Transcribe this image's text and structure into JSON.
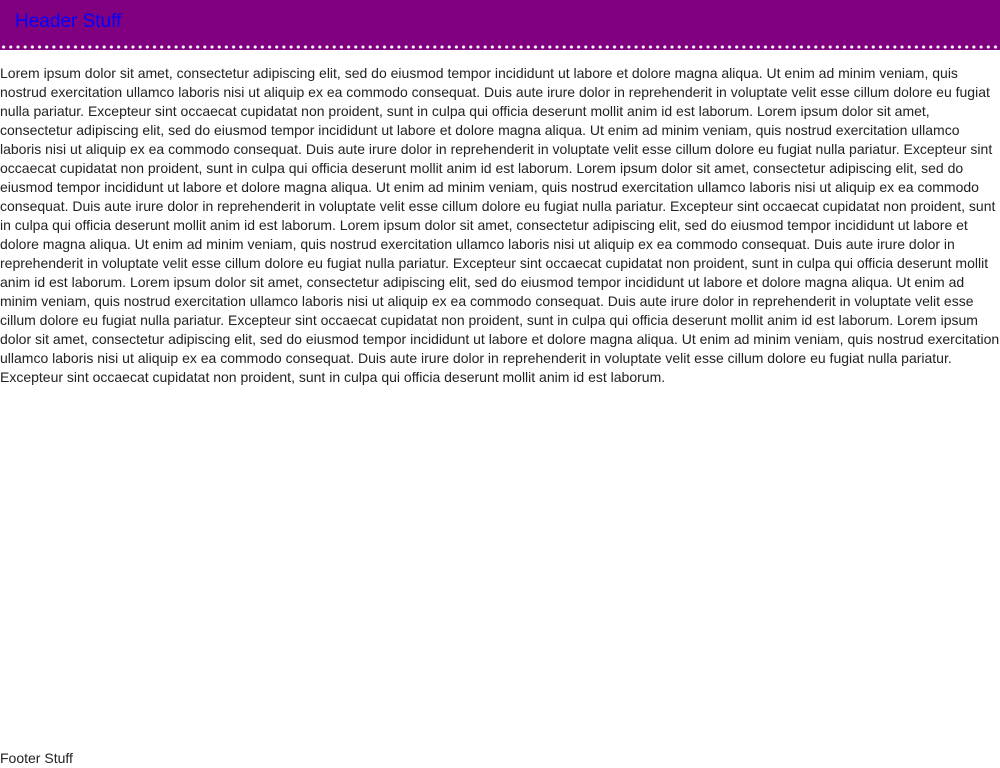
{
  "header": {
    "title": "Header Stuff"
  },
  "main": {
    "body_text": "Lorem ipsum dolor sit amet, consectetur adipiscing elit, sed do eiusmod tempor incididunt ut labore et dolore magna aliqua. Ut enim ad minim veniam, quis nostrud exercitation ullamco laboris nisi ut aliquip ex ea commodo consequat. Duis aute irure dolor in reprehenderit in voluptate velit esse cillum dolore eu fugiat nulla pariatur. Excepteur sint occaecat cupidatat non proident, sunt in culpa qui officia deserunt mollit anim id est laborum. Lorem ipsum dolor sit amet, consectetur adipiscing elit, sed do eiusmod tempor incididunt ut labore et dolore magna aliqua. Ut enim ad minim veniam, quis nostrud exercitation ullamco laboris nisi ut aliquip ex ea commodo consequat. Duis aute irure dolor in reprehenderit in voluptate velit esse cillum dolore eu fugiat nulla pariatur. Excepteur sint occaecat cupidatat non proident, sunt in culpa qui officia deserunt mollit anim id est laborum. Lorem ipsum dolor sit amet, consectetur adipiscing elit, sed do eiusmod tempor incididunt ut labore et dolore magna aliqua. Ut enim ad minim veniam, quis nostrud exercitation ullamco laboris nisi ut aliquip ex ea commodo consequat. Duis aute irure dolor in reprehenderit in voluptate velit esse cillum dolore eu fugiat nulla pariatur. Excepteur sint occaecat cupidatat non proident, sunt in culpa qui officia deserunt mollit anim id est laborum. Lorem ipsum dolor sit amet, consectetur adipiscing elit, sed do eiusmod tempor incididunt ut labore et dolore magna aliqua. Ut enim ad minim veniam, quis nostrud exercitation ullamco laboris nisi ut aliquip ex ea commodo consequat. Duis aute irure dolor in reprehenderit in voluptate velit esse cillum dolore eu fugiat nulla pariatur. Excepteur sint occaecat cupidatat non proident, sunt in culpa qui officia deserunt mollit anim id est laborum. Lorem ipsum dolor sit amet, consectetur adipiscing elit, sed do eiusmod tempor incididunt ut labore et dolore magna aliqua. Ut enim ad minim veniam, quis nostrud exercitation ullamco laboris nisi ut aliquip ex ea commodo consequat. Duis aute irure dolor in reprehenderit in voluptate velit esse cillum dolore eu fugiat nulla pariatur. Excepteur sint occaecat cupidatat non proident, sunt in culpa qui officia deserunt mollit anim id est laborum. Lorem ipsum dolor sit amet, consectetur adipiscing elit, sed do eiusmod tempor incididunt ut labore et dolore magna aliqua. Ut enim ad minim veniam, quis nostrud exercitation ullamco laboris nisi ut aliquip ex ea commodo consequat. Duis aute irure dolor in reprehenderit in voluptate velit esse cillum dolore eu fugiat nulla pariatur. Excepteur sint occaecat cupidatat non proident, sunt in culpa qui officia deserunt mollit anim id est laborum."
  },
  "footer": {
    "text": "Footer Stuff"
  },
  "colors": {
    "header_background": "#800080",
    "header_text": "#0000ff",
    "border_dots": "#ffffff",
    "body_text": "#222222",
    "page_background": "#ffffff"
  }
}
